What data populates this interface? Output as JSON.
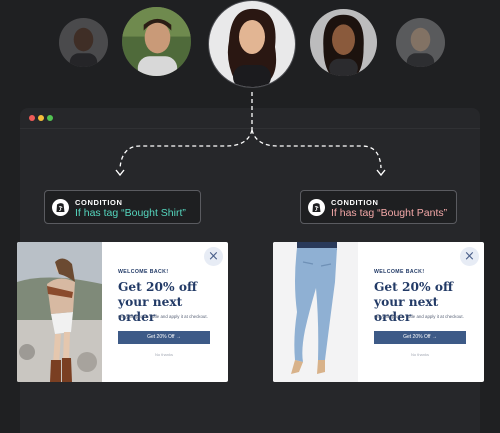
{
  "colors": {
    "background": "#1f2022",
    "shirt_accent": "#55d6be",
    "pants_accent": "#f2a7a7",
    "popup_navy": "#223a66",
    "button_blue": "#3d5a87"
  },
  "avatars": [
    {
      "name": "person-1"
    },
    {
      "name": "person-2"
    },
    {
      "name": "person-3-selected"
    },
    {
      "name": "person-4"
    },
    {
      "name": "person-5"
    }
  ],
  "conditions": [
    {
      "label": "CONDITION",
      "text": "If has tag “Bought Shirt”",
      "icon": "shopify-icon"
    },
    {
      "label": "CONDITION",
      "text": "If has tag “Bought Pants”",
      "icon": "shopify-icon"
    }
  ],
  "popups": [
    {
      "image": "shirt-model-photo",
      "welcome": "WELCOME BACK!",
      "headline": "Get 20% off your next order",
      "subtext": "Get your promo code and apply it at checkout.",
      "cta": "Get 20% Off  →",
      "dismiss": "No thanks",
      "close": "×"
    },
    {
      "image": "jeans-model-photo",
      "welcome": "WELCOME BACK!",
      "headline": "Get 20% off your next order",
      "subtext": "Get your promo code and apply it at checkout.",
      "cta": "Get 20% Off  →",
      "dismiss": "No thanks",
      "close": "×"
    }
  ]
}
